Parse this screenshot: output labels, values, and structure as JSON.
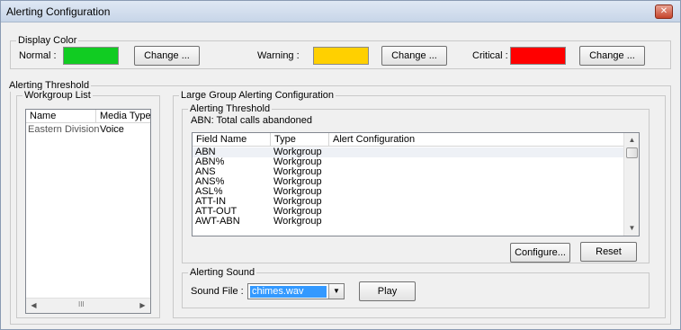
{
  "window": {
    "title": "Alerting Configuration",
    "close_glyph": "✕"
  },
  "display_color": {
    "legend": "Display Color",
    "normal": {
      "label": "Normal :",
      "color": "#11cc22",
      "button": "Change ..."
    },
    "warning": {
      "label": "Warning :",
      "color": "#ffd000",
      "button": "Change ..."
    },
    "critical": {
      "label": "Critical :",
      "color": "#ff0000",
      "button": "Change ..."
    }
  },
  "alerting_threshold": {
    "legend": "Alerting Threshold",
    "workgroup_list": {
      "legend": "Workgroup List",
      "columns": [
        "Name",
        "Media Type"
      ],
      "rows": [
        {
          "name": "Eastern Division",
          "media": "Voice"
        }
      ],
      "scroll_glyph": "III"
    },
    "large_group": {
      "legend": "Large Group Alerting Configuration",
      "threshold": {
        "legend": "Alerting Threshold",
        "field_description": "ABN: Total calls abandoned",
        "columns": [
          "Field Name",
          "Type",
          "Alert Configuration"
        ],
        "rows": [
          {
            "field": "ABN",
            "type": "Workgroup",
            "config": ""
          },
          {
            "field": "ABN%",
            "type": "Workgroup",
            "config": ""
          },
          {
            "field": "ANS",
            "type": "Workgroup",
            "config": ""
          },
          {
            "field": "ANS%",
            "type": "Workgroup",
            "config": ""
          },
          {
            "field": "ASL%",
            "type": "Workgroup",
            "config": ""
          },
          {
            "field": "ATT-IN",
            "type": "Workgroup",
            "config": ""
          },
          {
            "field": "ATT-OUT",
            "type": "Workgroup",
            "config": ""
          },
          {
            "field": "AWT-ABN",
            "type": "Workgroup",
            "config": ""
          }
        ],
        "configure_button": "Configure...",
        "reset_button": "Reset"
      },
      "sound": {
        "legend": "Alerting Sound",
        "label": "Sound File :",
        "selected": "chimes.wav",
        "play_button": "Play"
      }
    }
  }
}
